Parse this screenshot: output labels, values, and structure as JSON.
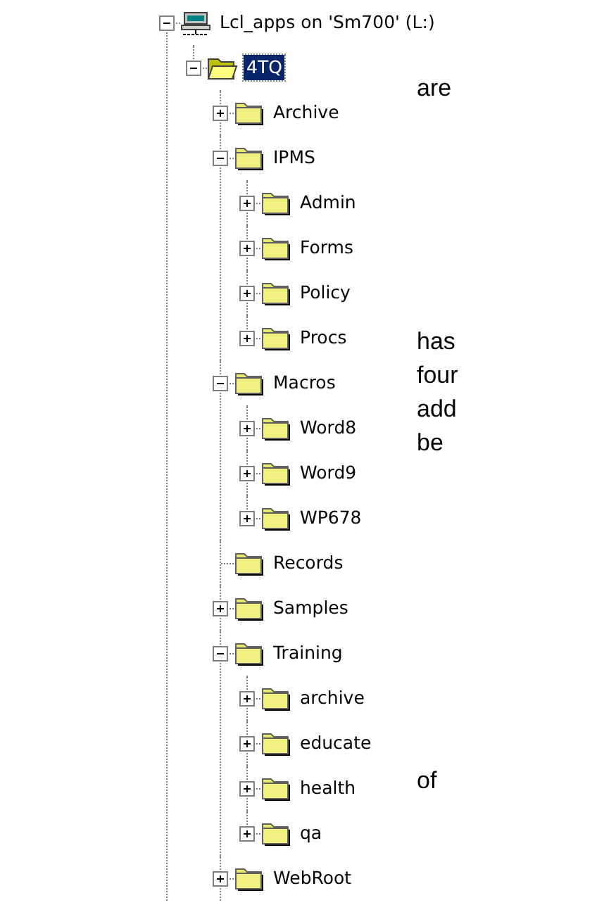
{
  "tree": [
    {
      "label": "Lcl_apps on 'Sm700' (L:)",
      "kind": "drive",
      "expanded": true,
      "selected": false,
      "more_below": true,
      "children": [
        {
          "label": "4TQ",
          "kind": "folder",
          "expanded": true,
          "selected": true,
          "more_below": false,
          "children": [
            {
              "label": "Archive",
              "kind": "folder",
              "expanded": false,
              "selected": false
            },
            {
              "label": "IPMS",
              "kind": "folder",
              "expanded": true,
              "selected": false,
              "children": [
                {
                  "label": "Admin",
                  "kind": "folder",
                  "expanded": false,
                  "selected": false
                },
                {
                  "label": "Forms",
                  "kind": "folder",
                  "expanded": false,
                  "selected": false
                },
                {
                  "label": "Policy",
                  "kind": "folder",
                  "expanded": false,
                  "selected": false
                },
                {
                  "label": "Procs",
                  "kind": "folder",
                  "expanded": false,
                  "selected": false,
                  "more_below": false
                }
              ]
            },
            {
              "label": "Macros",
              "kind": "folder",
              "expanded": true,
              "selected": false,
              "children": [
                {
                  "label": "Word8",
                  "kind": "folder",
                  "expanded": false,
                  "selected": false
                },
                {
                  "label": "Word9",
                  "kind": "folder",
                  "expanded": false,
                  "selected": false
                },
                {
                  "label": "WP678",
                  "kind": "folder",
                  "expanded": false,
                  "selected": false,
                  "more_below": false
                }
              ]
            },
            {
              "label": "Records",
              "kind": "folder",
              "selected": false
            },
            {
              "label": "Samples",
              "kind": "folder",
              "expanded": false,
              "selected": false
            },
            {
              "label": "Training",
              "kind": "folder",
              "expanded": true,
              "selected": false,
              "children": [
                {
                  "label": "archive",
                  "kind": "folder",
                  "expanded": false,
                  "selected": false
                },
                {
                  "label": "educate",
                  "kind": "folder",
                  "expanded": false,
                  "selected": false
                },
                {
                  "label": "health",
                  "kind": "folder",
                  "expanded": false,
                  "selected": false
                },
                {
                  "label": "qa",
                  "kind": "folder",
                  "expanded": false,
                  "selected": false,
                  "more_below": false
                }
              ]
            },
            {
              "label": "WebRoot",
              "kind": "folder",
              "expanded": false,
              "selected": false,
              "more_below": true
            }
          ]
        }
      ]
    }
  ],
  "side_text": [
    [
      "are"
    ],
    [
      "has",
      "four",
      "add",
      "be"
    ],
    [
      "of"
    ]
  ]
}
